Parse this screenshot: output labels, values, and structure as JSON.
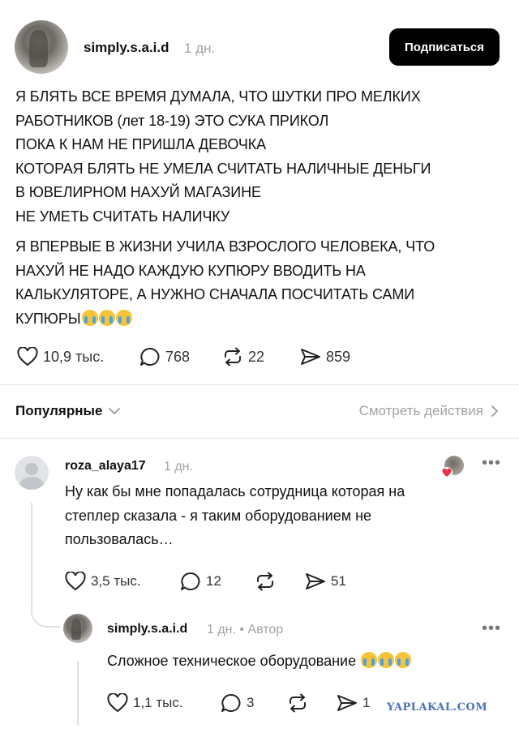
{
  "post": {
    "username": "simply.s.a.i.d",
    "time": "1 дн.",
    "subscribe_label": "Подписаться",
    "paragraph1": [
      "Я БЛЯТЬ ВСЕ ВРЕМЯ ДУМАЛА, ЧТО ШУТКИ ПРО МЕЛКИХ",
      "РАБОТНИКОВ (лет 18-19) ЭТО СУКА ПРИКОЛ",
      "ПОКА К НАМ НЕ ПРИШЛА ДЕВОЧКА",
      "КОТОРАЯ БЛЯТЬ НЕ УМЕЛА СЧИТАТЬ НАЛИЧНЫЕ ДЕНЬГИ",
      "В ЮВЕЛИРНОМ НАХУЙ МАГАЗИНЕ",
      "НЕ УМЕТЬ СЧИТАТЬ НАЛИЧКУ"
    ],
    "paragraph2": [
      "Я ВПЕРВЫЕ В ЖИЗНИ УЧИЛА ВЗРОСЛОГО ЧЕЛОВЕКА, ЧТО",
      "НАХУЙ НЕ НАДО КАЖДУЮ КУПЮРУ ВВОДИТЬ НА",
      "КАЛЬКУЛЯТОРЕ, А НУЖНО СНАЧАЛА ПОСЧИТАТЬ САМИ",
      "КУПЮРЫ"
    ],
    "likes": "10,9 тыс.",
    "replies": "768",
    "reposts": "22",
    "shares": "859"
  },
  "sort_bar": {
    "sort_label": "Популярные",
    "activity_label": "Смотреть действия"
  },
  "comment1": {
    "username": "roza_alaya17",
    "time": "1 дн.",
    "lines": [
      "Ну как бы мне попадалась сотрудница которая на",
      "степлер сказала - я таким оборудованием не",
      "пользовалась…"
    ],
    "likes": "3,5 тыс.",
    "replies": "12",
    "shares": "51"
  },
  "comment2": {
    "username": "simply.s.a.i.d",
    "time": "1 дн. • Автор",
    "text": "Сложное техническое оборудование",
    "likes": "1,1 тыс.",
    "replies": "3",
    "shares": "1"
  },
  "watermark": "YAPLAKAL.COM",
  "icons": {
    "like": "heart-icon",
    "reply": "speech-bubble-icon",
    "repost": "repost-arrows-icon",
    "share": "send-arrow-icon",
    "more": "more-dots-icon",
    "chevron": "chevron-icon",
    "emoji": "loudly-crying-face-emoji"
  },
  "colors": {
    "subscribe_bg": "#000000",
    "muted_text": "#a3a3a3",
    "watermark": "#4a72b8",
    "liker_heart": "#e8334a"
  }
}
